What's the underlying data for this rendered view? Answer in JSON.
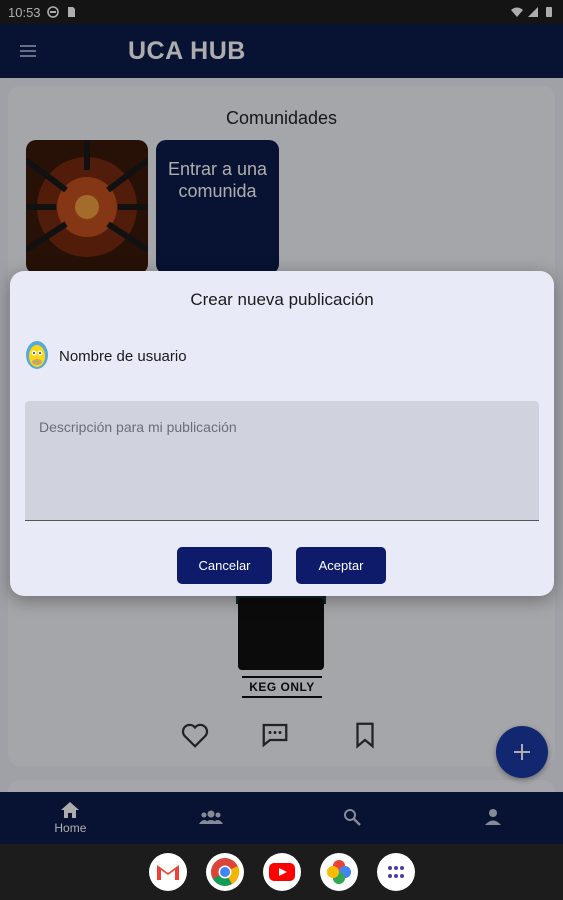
{
  "status_bar": {
    "time": "10:53"
  },
  "app_bar": {
    "title": "UCA HUB"
  },
  "communities": {
    "title": "Comunidades",
    "join_label": "Entrar a una comunida"
  },
  "post": {
    "caption": "KEG ONLY"
  },
  "bottom_nav": {
    "items": [
      {
        "label": "Home",
        "icon": "home-icon",
        "active": true
      },
      {
        "label": "",
        "icon": "groups-icon",
        "active": false
      },
      {
        "label": "",
        "icon": "search-icon",
        "active": false
      },
      {
        "label": "",
        "icon": "person-icon",
        "active": false
      }
    ]
  },
  "dialog": {
    "title": "Crear nueva publicación",
    "username": "Nombre de usuario",
    "description_placeholder": "Descripción para mi publicación",
    "cancel_label": "Cancelar",
    "accept_label": "Aceptar"
  },
  "dock": {
    "apps": [
      "Gmail",
      "Chrome",
      "YouTube",
      "Photos",
      "App drawer"
    ]
  },
  "colors": {
    "primary": "#0d1b4a",
    "button": "#0d1b6a",
    "fab": "#1a3aa6",
    "dialog_bg": "#e8ebf7"
  }
}
